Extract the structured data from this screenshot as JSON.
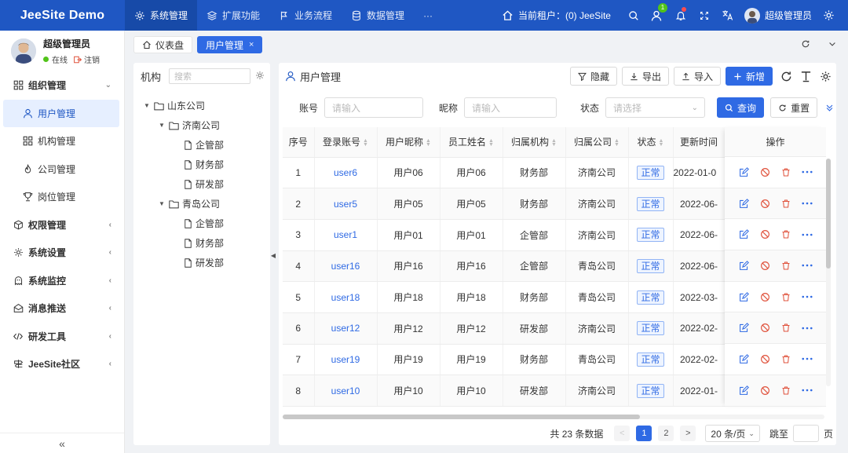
{
  "header": {
    "brand": "JeeSite Demo",
    "nav": [
      {
        "label": "系统管理",
        "icon": "gear-icon",
        "active": true
      },
      {
        "label": "扩展功能",
        "icon": "layers-icon",
        "active": false
      },
      {
        "label": "业务流程",
        "icon": "flow-icon",
        "active": false
      },
      {
        "label": "数据管理",
        "icon": "database-icon",
        "active": false
      }
    ],
    "more": "···",
    "tenant_label": "当前租户：(0) JeeSite",
    "notify_count": "1",
    "user_name": "超级管理员"
  },
  "sidebar": {
    "profile_name": "超级管理员",
    "status_online": "在线",
    "logout": "注销",
    "items": [
      {
        "label": "组织管理",
        "type": "group",
        "chev": "⌄"
      },
      {
        "label": "用户管理",
        "type": "sub",
        "active": true
      },
      {
        "label": "机构管理",
        "type": "sub"
      },
      {
        "label": "公司管理",
        "type": "sub"
      },
      {
        "label": "岗位管理",
        "type": "sub"
      },
      {
        "label": "权限管理",
        "type": "group",
        "chev": "‹"
      },
      {
        "label": "系统设置",
        "type": "group",
        "chev": "‹"
      },
      {
        "label": "系统监控",
        "type": "group",
        "chev": "‹"
      },
      {
        "label": "消息推送",
        "type": "group",
        "chev": "‹"
      },
      {
        "label": "研发工具",
        "type": "group",
        "chev": "‹"
      },
      {
        "label": "JeeSite社区",
        "type": "group",
        "chev": "‹"
      }
    ],
    "collapse": "«"
  },
  "tabs": [
    {
      "label": "仪表盘",
      "active": false
    },
    {
      "label": "用户管理",
      "active": true,
      "close": "×"
    }
  ],
  "org": {
    "title": "机构",
    "search_placeholder": "搜索",
    "tree": [
      {
        "label": "山东公司",
        "level": 0,
        "type": "folder"
      },
      {
        "label": "济南公司",
        "level": 1,
        "type": "folder"
      },
      {
        "label": "企管部",
        "level": 2,
        "type": "file"
      },
      {
        "label": "财务部",
        "level": 2,
        "type": "file"
      },
      {
        "label": "研发部",
        "level": 2,
        "type": "file"
      },
      {
        "label": "青岛公司",
        "level": 1,
        "type": "folder"
      },
      {
        "label": "企管部",
        "level": 2,
        "type": "file"
      },
      {
        "label": "财务部",
        "level": 2,
        "type": "file"
      },
      {
        "label": "研发部",
        "level": 2,
        "type": "file"
      }
    ]
  },
  "main": {
    "title": "用户管理",
    "toolbar": {
      "hide": "隐藏",
      "export": "导出",
      "import": "导入",
      "add": "新增"
    },
    "filter": {
      "account_label": "账号",
      "account_placeholder": "请输入",
      "nickname_label": "昵称",
      "nickname_placeholder": "请输入",
      "status_label": "状态",
      "status_placeholder": "请选择",
      "query": "查询",
      "reset": "重置"
    },
    "columns": [
      "序号",
      "登录账号",
      "用户昵称",
      "员工姓名",
      "归属机构",
      "归属公司",
      "状态",
      "更新时间"
    ],
    "ops_header": "操作",
    "rows": [
      {
        "no": "1",
        "account": "user6",
        "nick": "用户06",
        "name": "用户06",
        "dept": "财务部",
        "company": "济南公司",
        "status": "正常",
        "updated": "2022-01-0"
      },
      {
        "no": "2",
        "account": "user5",
        "nick": "用户05",
        "name": "用户05",
        "dept": "财务部",
        "company": "济南公司",
        "status": "正常",
        "updated": "2022-06-"
      },
      {
        "no": "3",
        "account": "user1",
        "nick": "用户01",
        "name": "用户01",
        "dept": "企管部",
        "company": "济南公司",
        "status": "正常",
        "updated": "2022-06-"
      },
      {
        "no": "4",
        "account": "user16",
        "nick": "用户16",
        "name": "用户16",
        "dept": "企管部",
        "company": "青岛公司",
        "status": "正常",
        "updated": "2022-06-"
      },
      {
        "no": "5",
        "account": "user18",
        "nick": "用户18",
        "name": "用户18",
        "dept": "财务部",
        "company": "青岛公司",
        "status": "正常",
        "updated": "2022-03-"
      },
      {
        "no": "6",
        "account": "user12",
        "nick": "用户12",
        "name": "用户12",
        "dept": "研发部",
        "company": "济南公司",
        "status": "正常",
        "updated": "2022-02-"
      },
      {
        "no": "7",
        "account": "user19",
        "nick": "用户19",
        "name": "用户19",
        "dept": "财务部",
        "company": "青岛公司",
        "status": "正常",
        "updated": "2022-02-"
      },
      {
        "no": "8",
        "account": "user10",
        "nick": "用户10",
        "name": "用户10",
        "dept": "研发部",
        "company": "济南公司",
        "status": "正常",
        "updated": "2022-01-"
      }
    ],
    "pager": {
      "total": "共 23 条数据",
      "pages": [
        "1",
        "2"
      ],
      "current": "1",
      "prev": "<",
      "next": ">",
      "page_size": "20 条/页",
      "goto_label": "跳至",
      "page_unit": "页"
    }
  },
  "colors": {
    "primary": "#2f6ae4",
    "header": "#1f57c3",
    "online": "#52c41a"
  }
}
